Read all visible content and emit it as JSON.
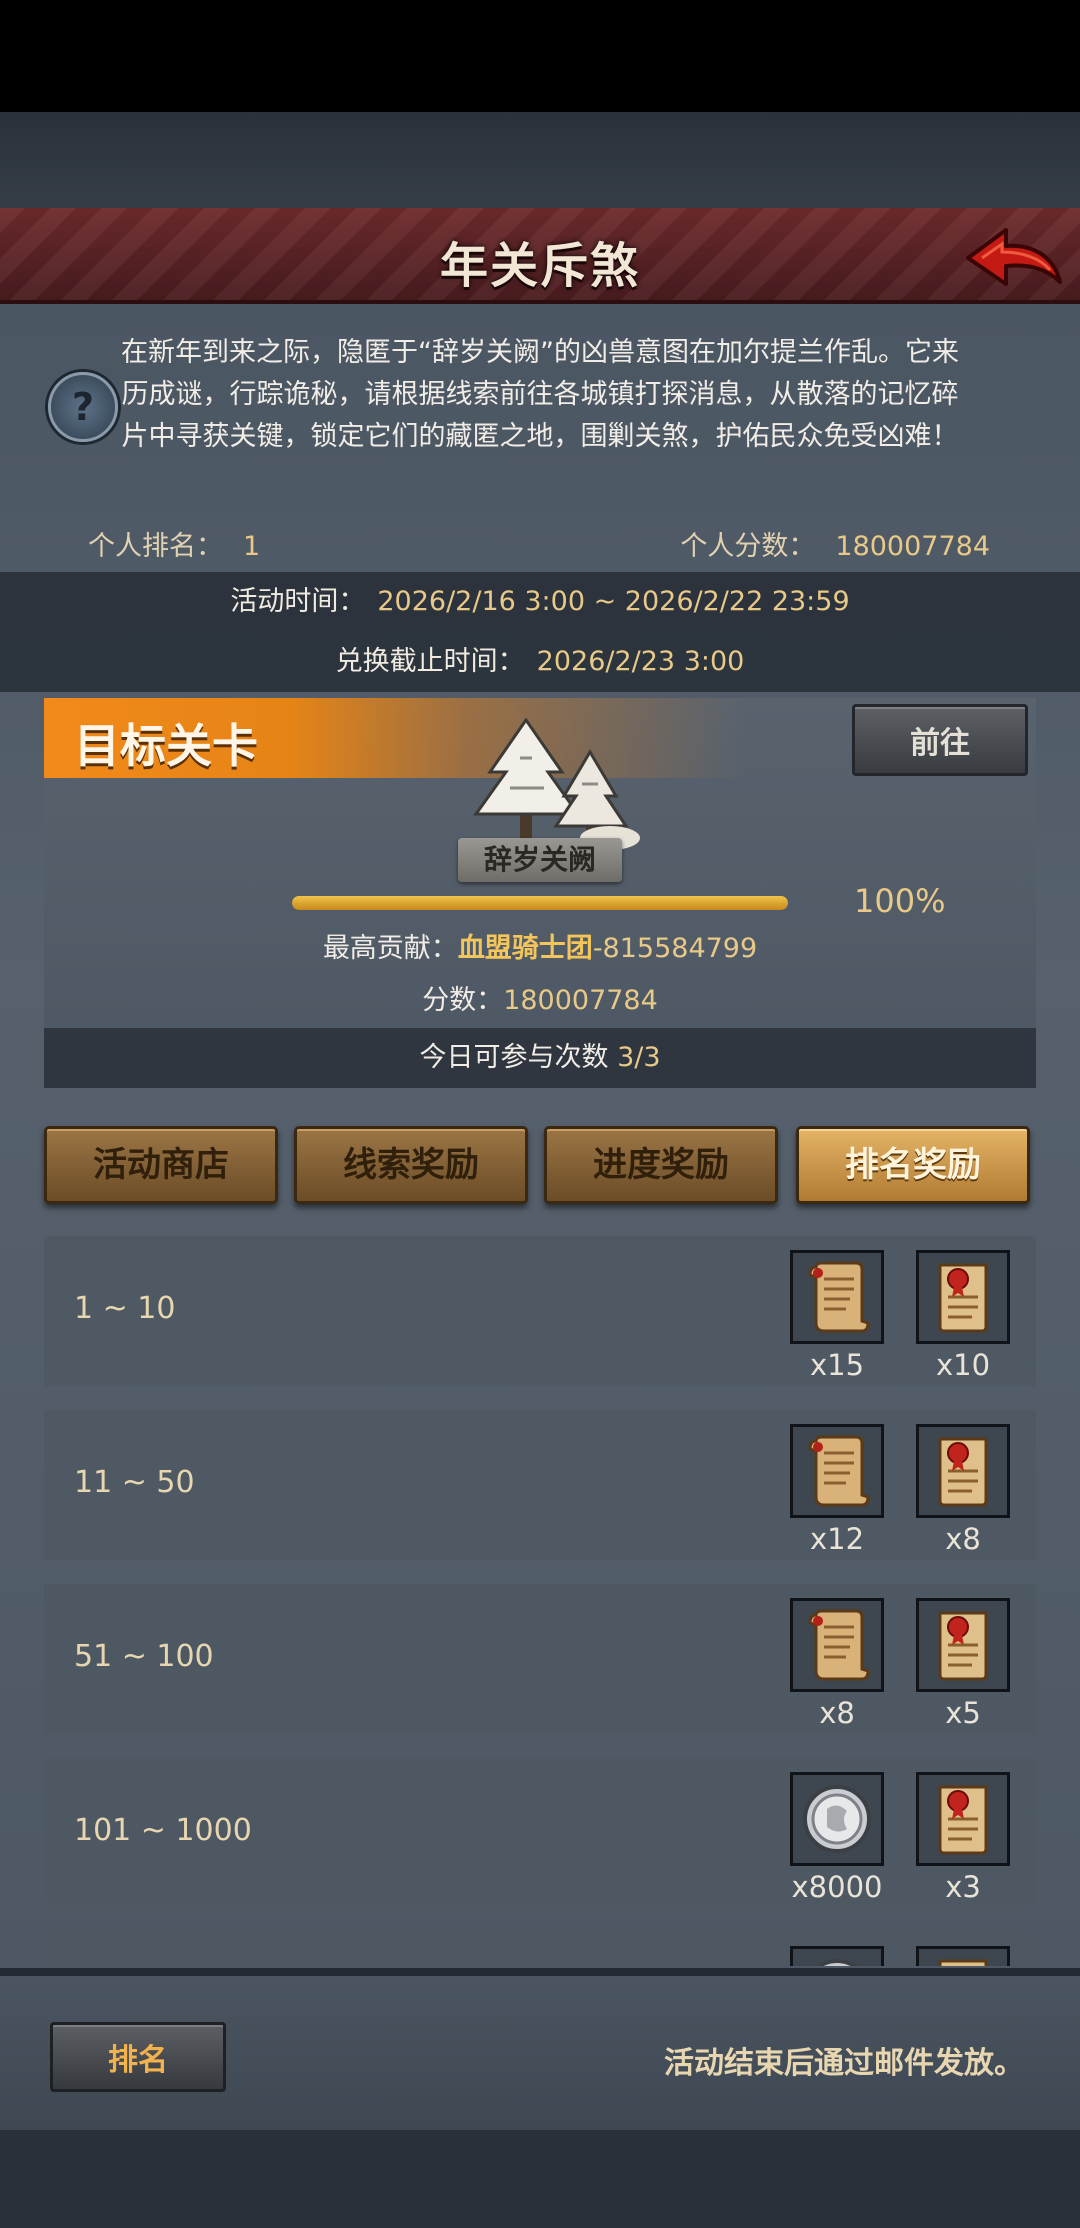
{
  "header": {
    "title": "年关斥煞"
  },
  "description": "在新年到来之际，隐匿于“辞岁关阙”的凶兽意图在加尔提兰作乱。它来历成谜，行踪诡秘，请根据线索前往各城镇打探消息，从散落的记忆碎片中寻获关键，锁定它们的藏匿之地，围剿关煞，护佑民众免受凶难！",
  "stats": {
    "rank_label": "个人排名：",
    "rank_value": "1",
    "score_label": "个人分数：",
    "score_value": "180007784"
  },
  "event_time": {
    "label": "活动时间：",
    "value": "2026/2/16 3:00 ~ 2026/2/22 23:59"
  },
  "exchange_deadline": {
    "label": "兑换截止时间：",
    "value": "2026/2/23 3:00"
  },
  "target": {
    "title": "目标关卡",
    "goto_label": "前往",
    "stage_name": "辞岁关阙",
    "progress": 1.0,
    "progress_text": "100%",
    "top_contrib_label": "最高贡献：",
    "top_contrib_guild": "血盟骑士团",
    "top_contrib_value": "-815584799",
    "score_label": "分数：",
    "score_value": "180007784",
    "attempts_label": "今日可参与次数",
    "attempts_value": "3/3"
  },
  "tabs": [
    {
      "label": "活动商店",
      "active": false
    },
    {
      "label": "线索奖励",
      "active": false
    },
    {
      "label": "进度奖励",
      "active": false
    },
    {
      "label": "排名奖励",
      "active": true
    }
  ],
  "rank_rewards": [
    {
      "range": "1 ~ 10",
      "rewards": [
        {
          "icon": "scroll-icon",
          "count": "x15"
        },
        {
          "icon": "sealed-letter-icon",
          "count": "x10"
        }
      ]
    },
    {
      "range": "11 ~ 50",
      "rewards": [
        {
          "icon": "scroll-icon",
          "count": "x12"
        },
        {
          "icon": "sealed-letter-icon",
          "count": "x8"
        }
      ]
    },
    {
      "range": "51 ~ 100",
      "rewards": [
        {
          "icon": "scroll-icon",
          "count": "x8"
        },
        {
          "icon": "sealed-letter-icon",
          "count": "x5"
        }
      ]
    },
    {
      "range": "101 ~ 1000",
      "rewards": [
        {
          "icon": "silver-coin-icon",
          "count": "x8000"
        },
        {
          "icon": "sealed-letter-icon",
          "count": "x3"
        }
      ]
    }
  ],
  "footer": {
    "rank_button": "排名",
    "mail_note": "活动结束后通过邮件发放。"
  },
  "colors": {
    "accent_orange": "#f08a1a",
    "gold_text": "#e8c988",
    "banner_red": "#6e2b2d"
  }
}
